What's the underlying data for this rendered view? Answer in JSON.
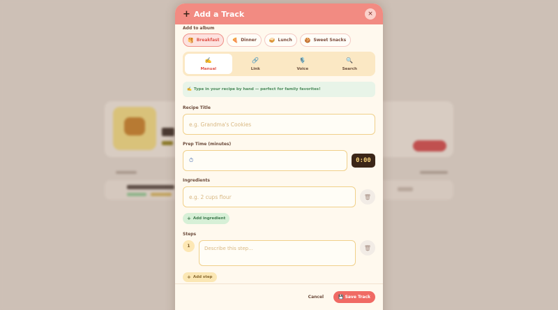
{
  "modal": {
    "title": "Add a Track",
    "close_icon": "×",
    "album_label": "Add to album",
    "albums": [
      {
        "emoji": "🥞",
        "label": "Breakfast",
        "active": true
      },
      {
        "emoji": "🍕",
        "label": "Dinner"
      },
      {
        "emoji": "🥪",
        "label": "Lunch"
      },
      {
        "emoji": "🍪",
        "label": "Sweet Snacks"
      }
    ],
    "tabs": [
      {
        "icon": "✍️",
        "label": "Manual",
        "active": true
      },
      {
        "icon": "🔗",
        "label": "Link"
      },
      {
        "icon": "🎙️",
        "label": "Voice"
      },
      {
        "icon": "🔍",
        "label": "Search"
      }
    ],
    "hint": {
      "icon": "✍️",
      "text": "Type in your recipe by hand — perfect for family favorites!"
    },
    "recipe_title": {
      "label": "Recipe Title",
      "placeholder": "e.g. Grandma's Cookies"
    },
    "prep_time": {
      "label": "Prep Time (minutes)",
      "timer": "0:00"
    },
    "ingredients": {
      "label": "Ingredients",
      "placeholder": "e.g. 2 cups flour",
      "add_label": "Add ingredient"
    },
    "steps": {
      "label": "Steps",
      "number": "1",
      "placeholder": "Describe this step...",
      "add_label": "Add step"
    },
    "footer": {
      "cancel": "Cancel",
      "save": "Save Track",
      "save_icon": "💾"
    }
  },
  "colors": {
    "header": "#f28b82",
    "accent": "#e0544a",
    "save": "#f06a64",
    "timer_bg": "#3b2618"
  }
}
